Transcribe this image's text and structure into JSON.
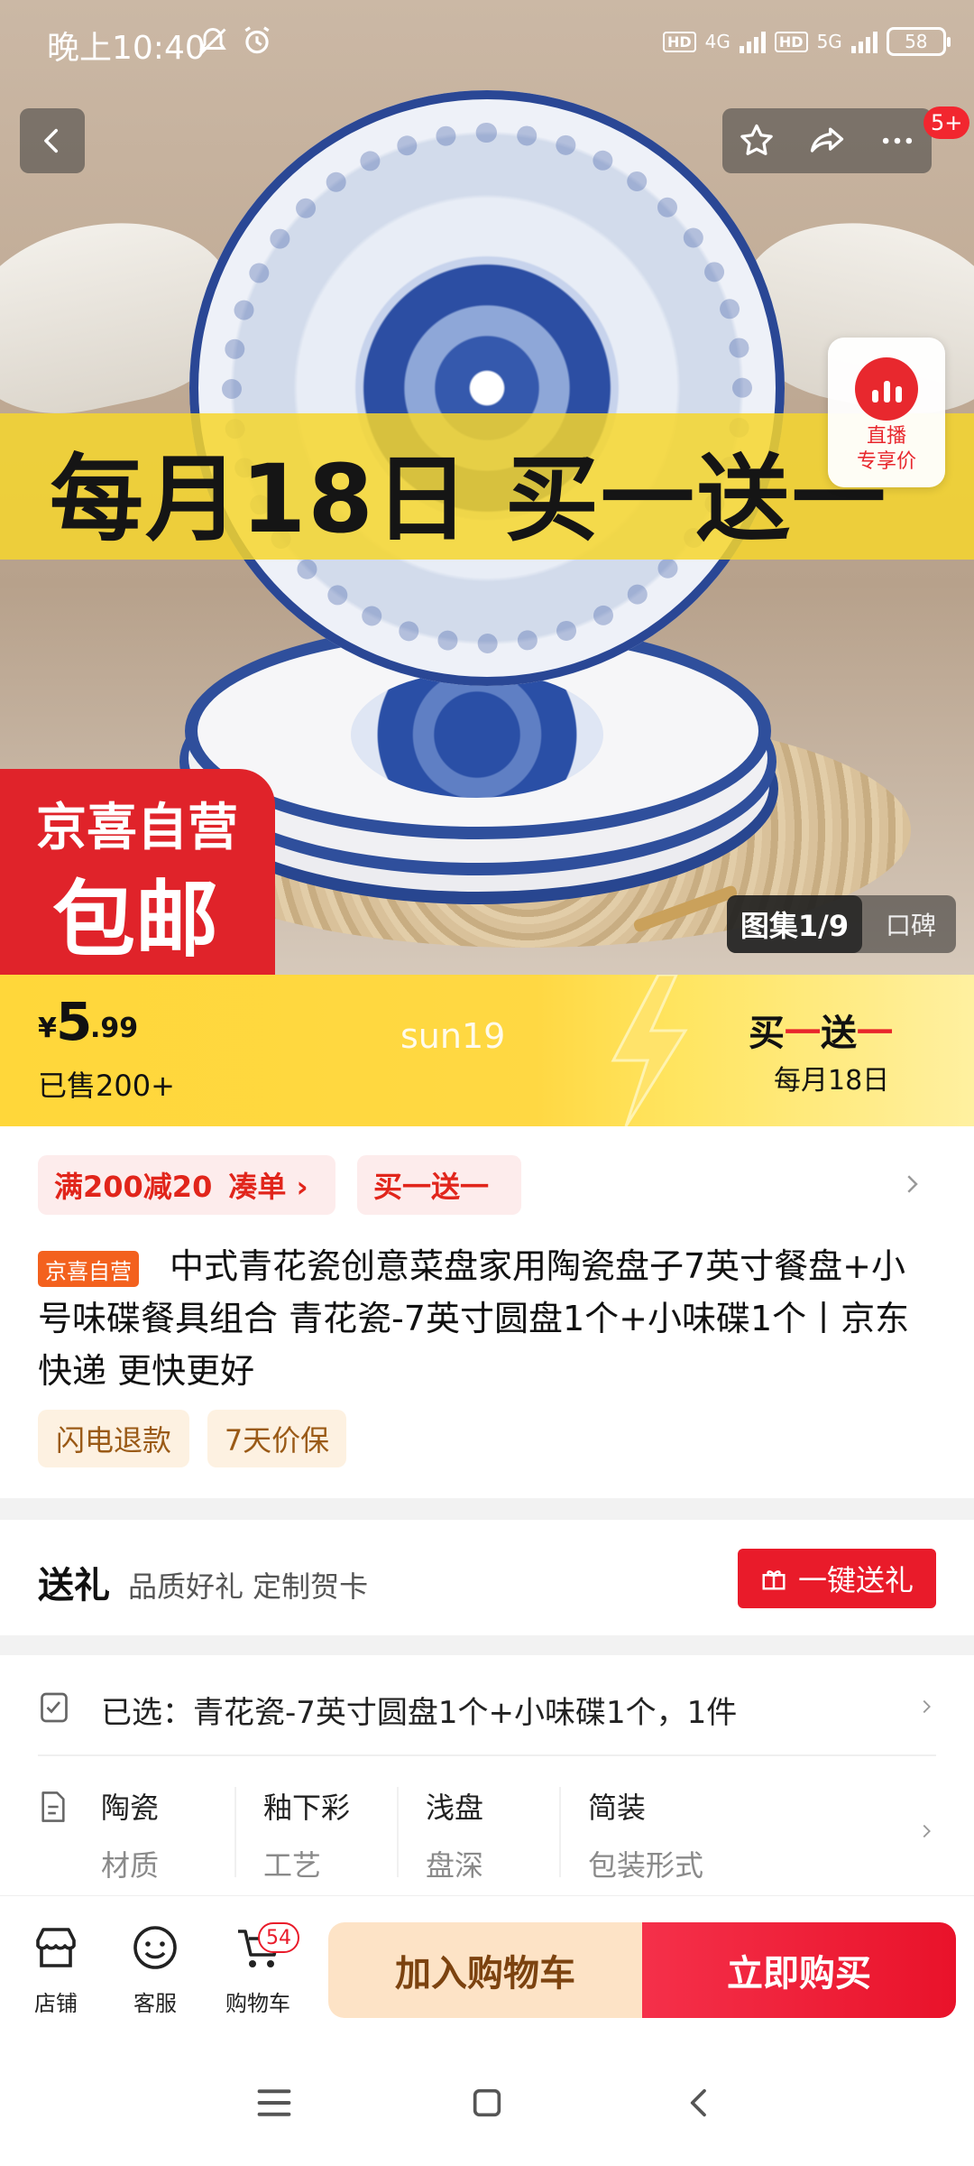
{
  "status_bar": {
    "time": "晚上10:40",
    "network_1": "4G",
    "network_2": "5G",
    "hd_label": "HD",
    "battery": "58"
  },
  "top_nav": {
    "message_badge": "5+"
  },
  "hero": {
    "promo_banner": "每月18日 买一送一",
    "shipping_badge_line1": "京喜自营",
    "shipping_badge_line2": "包邮",
    "gallery_counter": "图集1/9",
    "reviews_tab": "口碑",
    "live_label_line1": "直播",
    "live_label_line2": "专享价"
  },
  "price_bar": {
    "currency": "¥",
    "price_integer": "5",
    "price_decimal": ".99",
    "sold": "已售200+",
    "watermark": "sun19",
    "promo_title_part1": "买",
    "promo_title_part2": "一",
    "promo_title_part3": "送",
    "promo_title_part4": "一",
    "promo_subtitle": "每月18日"
  },
  "coupons": [
    {
      "label": "满200减20"
    },
    {
      "label": "凑单 ›"
    },
    {
      "label": "买一送一"
    }
  ],
  "product": {
    "tag": "京喜自营",
    "title": "中式青花瓷创意菜盘家用陶瓷盘子7英寸餐盘+小号味碟餐具组合 青花瓷-7英寸圆盘1个+小味碟1个丨京东快递 更快更好",
    "service_tags": [
      "闪电退款",
      "7天价保"
    ]
  },
  "gift": {
    "title": "送礼",
    "subtitle": "品质好礼 定制贺卡",
    "button": "一键送礼"
  },
  "selection": {
    "text": "已选：青花瓷-7英寸圆盘1个+小味碟1个，1件"
  },
  "specs": [
    {
      "value": "陶瓷",
      "key": "材质"
    },
    {
      "value": "釉下彩",
      "key": "工艺"
    },
    {
      "value": "浅盘",
      "key": "盘深"
    },
    {
      "value": "简装",
      "key": "包装形式"
    }
  ],
  "bottom_bar": {
    "store": "店铺",
    "service": "客服",
    "cart": "购物车",
    "cart_count": "54",
    "add_to_cart": "加入购物车",
    "buy_now": "立即购买"
  },
  "colors": {
    "brand_red": "#e91b2a",
    "promo_yellow": "#ffd73a",
    "cart_button_bg": "#fde3c6",
    "jx_orange": "#f3611e"
  },
  "icons": [
    "back-icon",
    "star-icon",
    "share-icon",
    "more-icon",
    "live-icon",
    "gift-icon",
    "selected-sku-icon",
    "spec-sheet-icon",
    "store-icon",
    "service-icon",
    "cart-icon",
    "menu-icon",
    "home-icon",
    "back-nav-icon"
  ]
}
